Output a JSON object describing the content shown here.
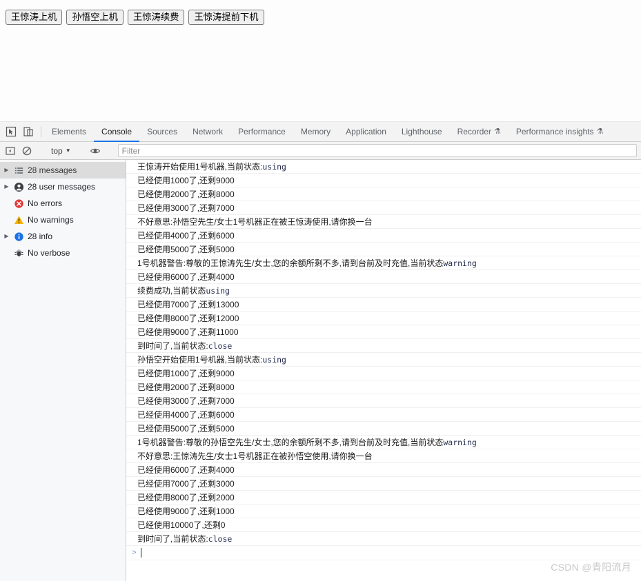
{
  "page": {
    "buttons": [
      {
        "label": "王惊涛上机",
        "name": "wangjingtao-start-button"
      },
      {
        "label": "孙悟空上机",
        "name": "sunwukong-start-button"
      },
      {
        "label": "王惊涛续费",
        "name": "wangjingtao-renew-button"
      },
      {
        "label": "王惊涛提前下机",
        "name": "wangjingtao-early-stop-button"
      }
    ]
  },
  "devtools": {
    "tabs": [
      {
        "label": "Elements",
        "active": false,
        "experimental": false
      },
      {
        "label": "Console",
        "active": true,
        "experimental": false
      },
      {
        "label": "Sources",
        "active": false,
        "experimental": false
      },
      {
        "label": "Network",
        "active": false,
        "experimental": false
      },
      {
        "label": "Performance",
        "active": false,
        "experimental": false
      },
      {
        "label": "Memory",
        "active": false,
        "experimental": false
      },
      {
        "label": "Application",
        "active": false,
        "experimental": false
      },
      {
        "label": "Lighthouse",
        "active": false,
        "experimental": false
      },
      {
        "label": "Recorder",
        "active": false,
        "experimental": true
      },
      {
        "label": "Performance insights",
        "active": false,
        "experimental": true
      }
    ],
    "filterbar": {
      "context_value": "top",
      "filter_placeholder": "Filter",
      "filter_value": ""
    },
    "sidebar": [
      {
        "label": "28 messages",
        "icon": "list-icon",
        "expandable": true,
        "selected": true
      },
      {
        "label": "28 user messages",
        "icon": "user-icon",
        "expandable": true,
        "selected": false
      },
      {
        "label": "No errors",
        "icon": "error-icon",
        "expandable": false,
        "selected": false
      },
      {
        "label": "No warnings",
        "icon": "warning-icon",
        "expandable": false,
        "selected": false
      },
      {
        "label": "28 info",
        "icon": "info-icon",
        "expandable": true,
        "selected": false
      },
      {
        "label": "No verbose",
        "icon": "verbose-icon",
        "expandable": false,
        "selected": false
      }
    ],
    "messages": [
      {
        "text": "王惊涛开始使用1号机器,当前状态:",
        "mono": "using"
      },
      {
        "text": "已经使用1000了,还剩9000",
        "mono": ""
      },
      {
        "text": "已经使用2000了,还剩8000",
        "mono": ""
      },
      {
        "text": "已经使用3000了,还剩7000",
        "mono": ""
      },
      {
        "text": "不好意思:孙悟空先生/女士1号机器正在被王惊涛使用,请你换一台",
        "mono": ""
      },
      {
        "text": "已经使用4000了,还剩6000",
        "mono": ""
      },
      {
        "text": "已经使用5000了,还剩5000",
        "mono": ""
      },
      {
        "text": "1号机器警告:尊敬的王惊涛先生/女士,您的余额所剩不多,请到台前及时充值,当前状态",
        "mono": "warning"
      },
      {
        "text": "已经使用6000了,还剩4000",
        "mono": ""
      },
      {
        "text": "续费成功,当前状态",
        "mono": "using"
      },
      {
        "text": "已经使用7000了,还剩13000",
        "mono": ""
      },
      {
        "text": "已经使用8000了,还剩12000",
        "mono": ""
      },
      {
        "text": "已经使用9000了,还剩11000",
        "mono": ""
      },
      {
        "text": "到时间了,当前状态:",
        "mono": "close"
      },
      {
        "text": "孙悟空开始使用1号机器,当前状态:",
        "mono": "using"
      },
      {
        "text": "已经使用1000了,还剩9000",
        "mono": ""
      },
      {
        "text": "已经使用2000了,还剩8000",
        "mono": ""
      },
      {
        "text": "已经使用3000了,还剩7000",
        "mono": ""
      },
      {
        "text": "已经使用4000了,还剩6000",
        "mono": ""
      },
      {
        "text": "已经使用5000了,还剩5000",
        "mono": ""
      },
      {
        "text": "1号机器警告:尊敬的孙悟空先生/女士,您的余额所剩不多,请到台前及时充值,当前状态",
        "mono": "warning"
      },
      {
        "text": "不好意思:王惊涛先生/女士1号机器正在被孙悟空使用,请你换一台",
        "mono": ""
      },
      {
        "text": "已经使用6000了,还剩4000",
        "mono": ""
      },
      {
        "text": "已经使用7000了,还剩3000",
        "mono": ""
      },
      {
        "text": "已经使用8000了,还剩2000",
        "mono": ""
      },
      {
        "text": "已经使用9000了,还剩1000",
        "mono": ""
      },
      {
        "text": "已经使用10000了,还剩0",
        "mono": ""
      },
      {
        "text": "到时间了,当前状态:",
        "mono": "close"
      }
    ],
    "prompt": {
      "arrow": ">",
      "value": ""
    }
  },
  "watermark": {
    "text": "CSDN @青阳流月"
  },
  "colors": {
    "accent": "#1a73e8",
    "error": "#e53935",
    "warning": "#f5b400",
    "info": "#1a73e8",
    "mono_text": "#222b4d"
  }
}
